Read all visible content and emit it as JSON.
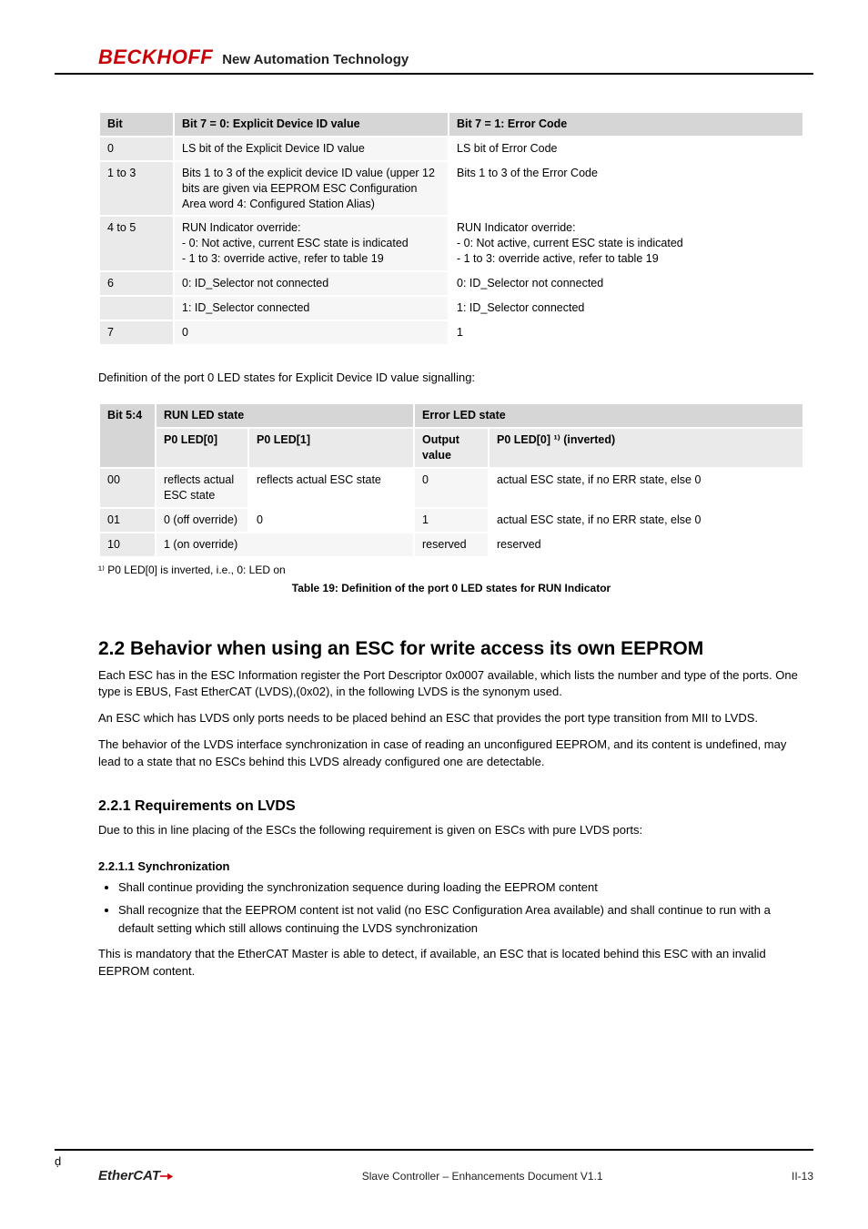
{
  "brand": {
    "logo": "BECKHOFF",
    "tag": "New Automation Technology"
  },
  "table1": {
    "headers": [
      "Bit",
      "Bit 7 = 0: Explicit Device ID value",
      "Bit 7 = 1: Error Code"
    ],
    "rows": [
      {
        "bit": "0",
        "a": "LS bit of the Explicit Device ID value",
        "b": "LS bit of Error Code"
      },
      {
        "bit": "1 to 3",
        "a": "Bits 1 to 3 of the explicit device ID value (upper 12 bits are given via EEPROM ESC Configuration Area word 4: Configured Station Alias)",
        "b": "Bits 1 to 3 of the Error Code"
      },
      {
        "bit": "4 to 5",
        "a": "RUN Indicator override:\n- 0: Not active, current ESC state is indicated\n- 1 to 3: override active, refer to table 19",
        "b": "RUN Indicator override:\n- 0: Not active, current ESC state is indicated\n- 1 to 3: override active, refer to table 19"
      },
      {
        "bit": "6",
        "a": "0: ID_Selector not connected",
        "b": "0: ID_Selector not connected"
      },
      {
        "bit": "",
        "a": "1: ID_Selector connected",
        "b": "1: ID_Selector connected"
      },
      {
        "bit": "7",
        "a": "0",
        "b": "1"
      }
    ],
    "caption": "Definition of the port 0 LED states for Explicit Device ID value signalling:"
  },
  "table2": {
    "header_top": {
      "c1": "Bit 5:4",
      "c2": "RUN LED state",
      "c3": "Error LED state"
    },
    "header_sub": {
      "c1": "",
      "c2": "P0 LED[0]",
      "c3": "P0 LED[1]",
      "c4": "Output value",
      "c5": "P0 LED[0] ¹⁾ (inverted)"
    },
    "rows": [
      {
        "c0": "00",
        "c1": "reflects actual ESC state",
        "c2": "reflects actual ESC state",
        "c3": "0",
        "c4": "actual ESC state, if no ERR state, else 0"
      },
      {
        "c0": "01",
        "c1": "0 (off override)",
        "c2": "0",
        "c3": "1",
        "c4": "actual ESC state, if no ERR state, else 0"
      },
      {
        "c0": "10",
        "c1": "1 (on override)",
        "c2": "reserved",
        "c3": "reserved",
        "c4": "reserved"
      }
    ],
    "footnote": "¹⁾ P0 LED[0] is inverted, i.e., 0: LED on",
    "caption": "Table 19: Definition of the port 0 LED states for RUN Indicator"
  },
  "sections": {
    "behavior_title": "2.2 Behavior when using an ESC for write access its own EEPROM",
    "behavior_p1": "Each ESC has in the ESC Information register the Port Descriptor 0x0007 available, which lists the number and type of the ports. One type is EBUS, Fast EtherCAT (LVDS),(0x02), in the following LVDS is the synonym used.",
    "behavior_p2": "An ESC which has LVDS only ports needs to be placed behind an ESC that provides the port type transition from MII to LVDS.",
    "behavior_p3": "The behavior of the LVDS interface synchronization in case of reading an unconfigured EEPROM, and its content is undefined, may lead to a state that no ESCs behind this LVDS already configured one are detectable.",
    "behavior_sub": "2.2.1 Requirements on LVDS",
    "behavior_subp": "Due to this in line placing of the ESCs the following requirement is given on ESCs with pure LVDS ports:",
    "behavior_sub2": "2.2.1.1 Synchronization",
    "behavior_bullets": [
      "Shall continue providing the synchronization sequence during loading the EEPROM content",
      "Shall recognize that the EEPROM content ist not valid (no ESC Configuration Area available) and shall continue to run with a default setting which still allows continuing the LVDS synchronization"
    ],
    "behavior_last": "This is mandatory that the EtherCAT Master is able to detect, if available, an ESC that is located behind this ESC with an invalid EEPROM content."
  },
  "footer": {
    "left_logo": "EtherCAT",
    "center": "Slave Controller – Enhancements Document V1.1",
    "right": "II-13"
  }
}
